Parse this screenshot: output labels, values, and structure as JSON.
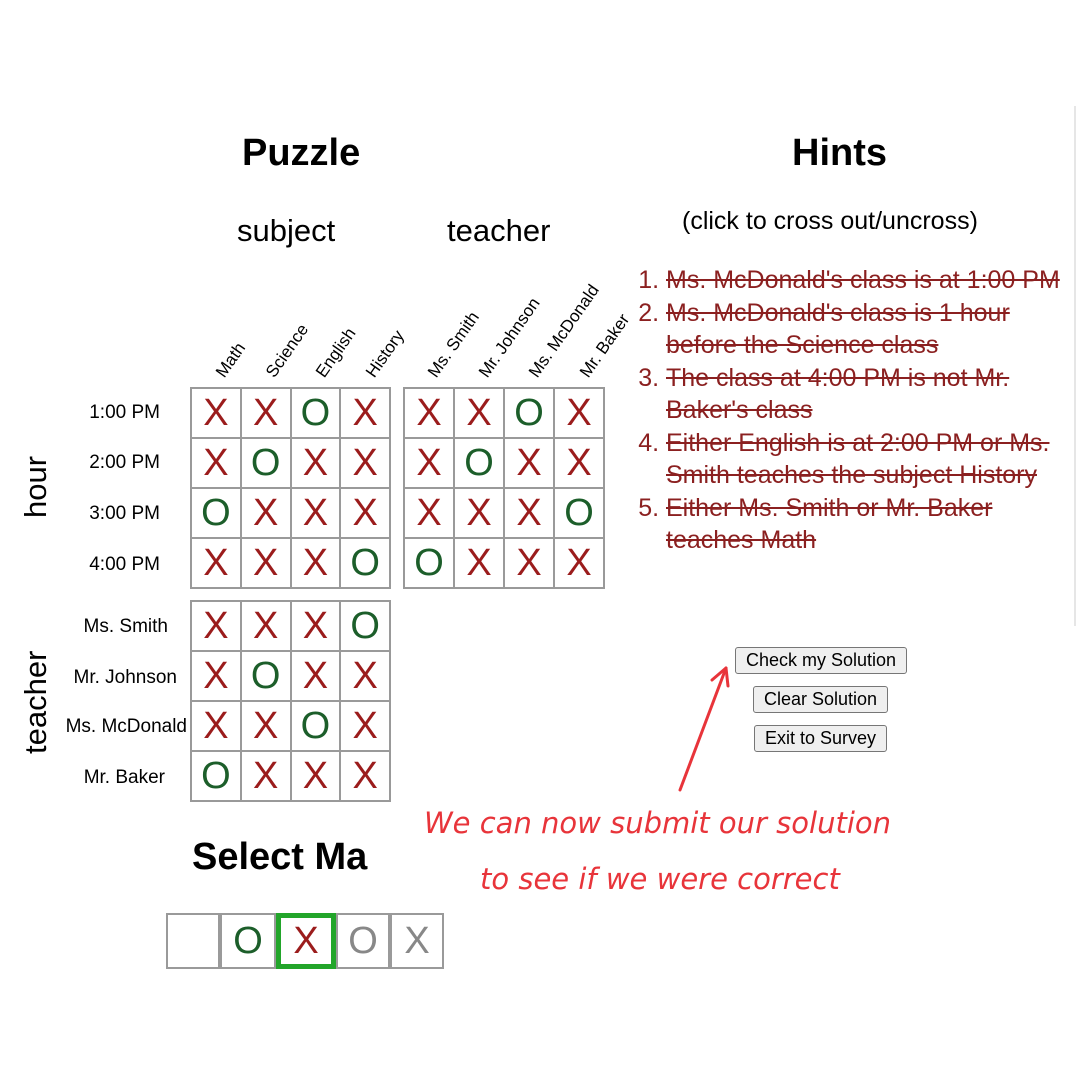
{
  "puzzle": {
    "title": "Puzzle",
    "group_subject": "subject",
    "group_teacher": "teacher",
    "col_subjects": [
      "Math",
      "Science",
      "English",
      "History"
    ],
    "col_teachers": [
      "Ms. Smith",
      "Mr. Johnson",
      "Ms. McDonald",
      "Mr. Baker"
    ],
    "axis_hour": "hour",
    "axis_teacher": "teacher",
    "row_hours": [
      "1:00 PM",
      "2:00 PM",
      "3:00 PM",
      "4:00 PM"
    ],
    "row_teachers": [
      "Ms. Smith",
      "Mr. Johnson",
      "Ms. McDonald",
      "Mr. Baker"
    ],
    "grid_hour_subject": [
      [
        "X",
        "X",
        "O",
        "X"
      ],
      [
        "X",
        "O",
        "X",
        "X"
      ],
      [
        "O",
        "X",
        "X",
        "X"
      ],
      [
        "X",
        "X",
        "X",
        "O"
      ]
    ],
    "grid_hour_teacher": [
      [
        "X",
        "X",
        "O",
        "X"
      ],
      [
        "X",
        "O",
        "X",
        "X"
      ],
      [
        "X",
        "X",
        "X",
        "O"
      ],
      [
        "O",
        "X",
        "X",
        "X"
      ]
    ],
    "grid_teacher_subject": [
      [
        "X",
        "X",
        "X",
        "O"
      ],
      [
        "X",
        "O",
        "X",
        "X"
      ],
      [
        "X",
        "X",
        "O",
        "X"
      ],
      [
        "O",
        "X",
        "X",
        "X"
      ]
    ]
  },
  "hints": {
    "title": "Hints",
    "subtitle": "(click to cross out/uncross)",
    "items": [
      "Ms. McDonald's class is at 1:00 PM",
      "Ms. McDonald's class is 1 hour before the Science class",
      "The class at 4:00 PM is not Mr. Baker's class",
      "Either English is at 2:00 PM or Ms. Smith teaches the subject History",
      "Either Ms. Smith or Mr. Baker teaches Math"
    ]
  },
  "buttons": {
    "check": "Check my Solution",
    "clear": "Clear Solution",
    "exit": "Exit to Survey"
  },
  "select_mark": {
    "title": "Select Ma",
    "options": [
      "",
      "O",
      "X",
      "O",
      "X"
    ],
    "selected_index": 2
  },
  "annotation": {
    "line1": "We can now submit our solution",
    "line2": "to see if we were correct"
  },
  "colors": {
    "x_mark": "#9b1c1c",
    "o_mark": "#1c5e2a",
    "hint_text": "#8b2020",
    "annotation": "#e8343a",
    "selected_border": "#22a52a",
    "faded_mark": "#888888"
  }
}
